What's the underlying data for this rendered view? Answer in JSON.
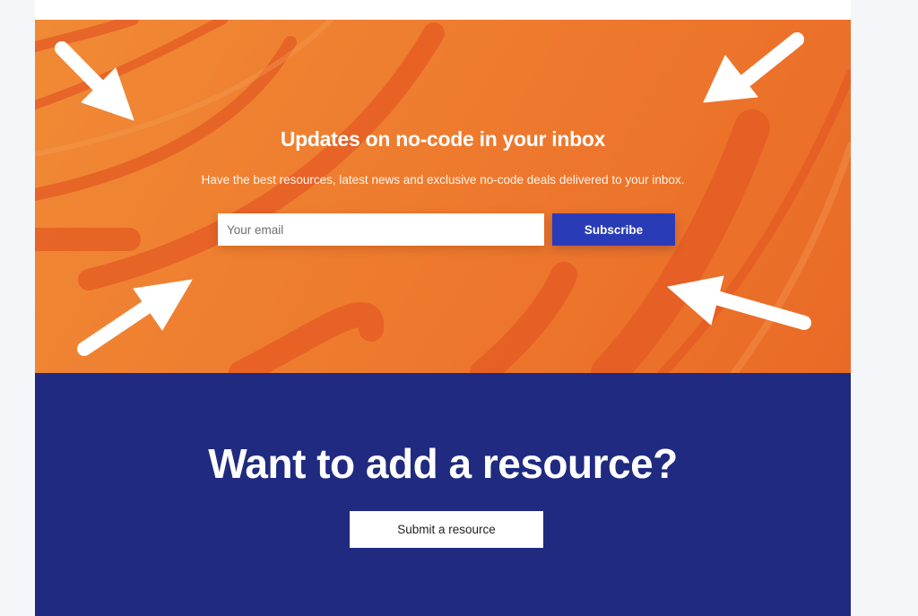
{
  "newsletter": {
    "title": "Updates on no-code in your inbox",
    "description": "Have the best resources, latest news and exclusive no-code deals delivered to your inbox.",
    "email_placeholder": "Your email",
    "subscribe_label": "Subscribe"
  },
  "resource": {
    "title": "Want to add a resource?",
    "submit_label": "Submit a resource"
  },
  "colors": {
    "orange": "#ee7a2e",
    "navy": "#1f2a80",
    "subscribe_blue": "#2a3bb8"
  }
}
